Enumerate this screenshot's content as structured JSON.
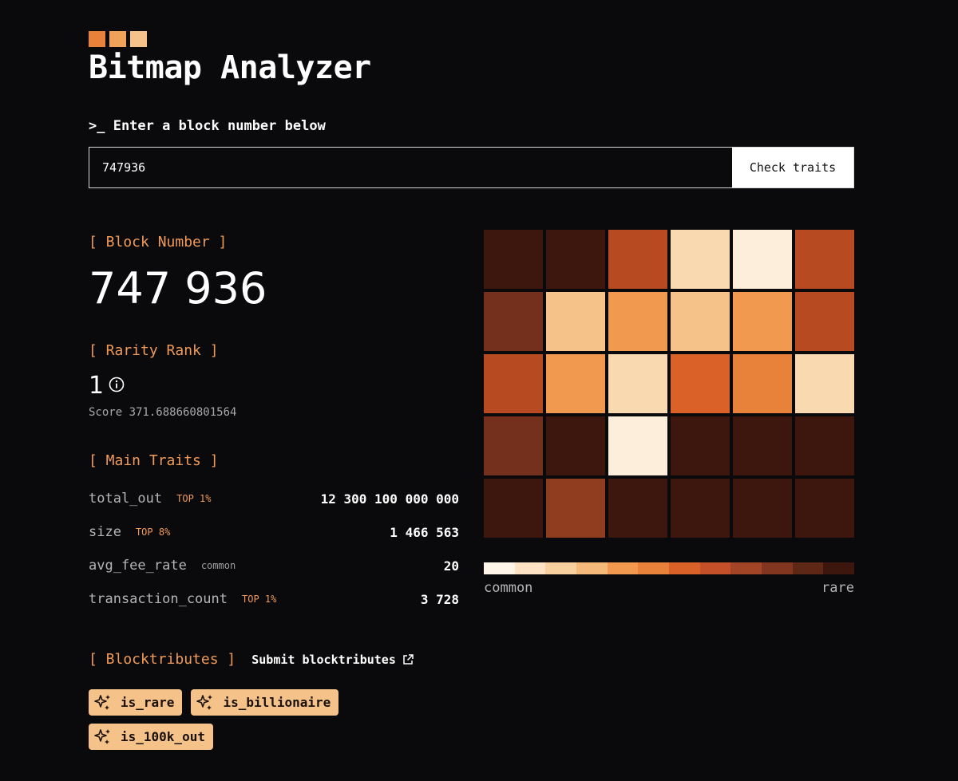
{
  "logo": {
    "colors": [
      "#e8813a",
      "#f0a25a",
      "#f5c28a"
    ]
  },
  "title": "Bitmap Analyzer",
  "prompt": ">_ Enter a block number below",
  "search": {
    "value": "747936",
    "button_label": "Check traits"
  },
  "block_number": {
    "label": "[ Block Number ]",
    "value": "747 936"
  },
  "rarity": {
    "label": "[ Rarity Rank ]",
    "rank": "1",
    "score": "Score 371.688660801564"
  },
  "main_traits": {
    "label": "[ Main Traits ]",
    "items": [
      {
        "name": "total_out",
        "badge": "TOP 1%",
        "value": "12 300 100 000 000"
      },
      {
        "name": "size",
        "badge": "TOP 8%",
        "value": "1 466 563"
      },
      {
        "name": "avg_fee_rate",
        "badge": "common",
        "value": "20"
      },
      {
        "name": "transaction_count",
        "badge": "TOP 1%",
        "value": "3 728"
      }
    ]
  },
  "blocktributes": {
    "label": "[ Blocktributes ]",
    "link_label": "Submit blocktributes",
    "chips": [
      "is_rare",
      "is_billionaire",
      "is_100k_out"
    ]
  },
  "grid": {
    "colors": [
      [
        "#3d170d",
        "#3d170d",
        "#b84a22",
        "#f8d9b0",
        "#fdeedb",
        "#b84a22"
      ],
      [
        "#74301c",
        "#f5c28a",
        "#f0994f",
        "#f5c28a",
        "#f0994f",
        "#b84a22"
      ],
      [
        "#b84a22",
        "#f0994f",
        "#f8d9b0",
        "#da6128",
        "#e8813a",
        "#f8d9b0"
      ],
      [
        "#74301c",
        "#3d170d",
        "#fdeedb",
        "#3d170d",
        "#3d170d",
        "#3d170d"
      ],
      [
        "#3d170d",
        "#903c1e",
        "#3d170d",
        "#3d170d",
        "#3d170d",
        "#3d170d"
      ]
    ]
  },
  "legend": {
    "colors": [
      "#fff5e8",
      "#fde3c4",
      "#f8d0a0",
      "#f5b97a",
      "#f0994f",
      "#e8813a",
      "#da6128",
      "#c4502a",
      "#a24426",
      "#823620",
      "#5e2816",
      "#3d170d"
    ],
    "min_label": "common",
    "max_label": "rare"
  }
}
